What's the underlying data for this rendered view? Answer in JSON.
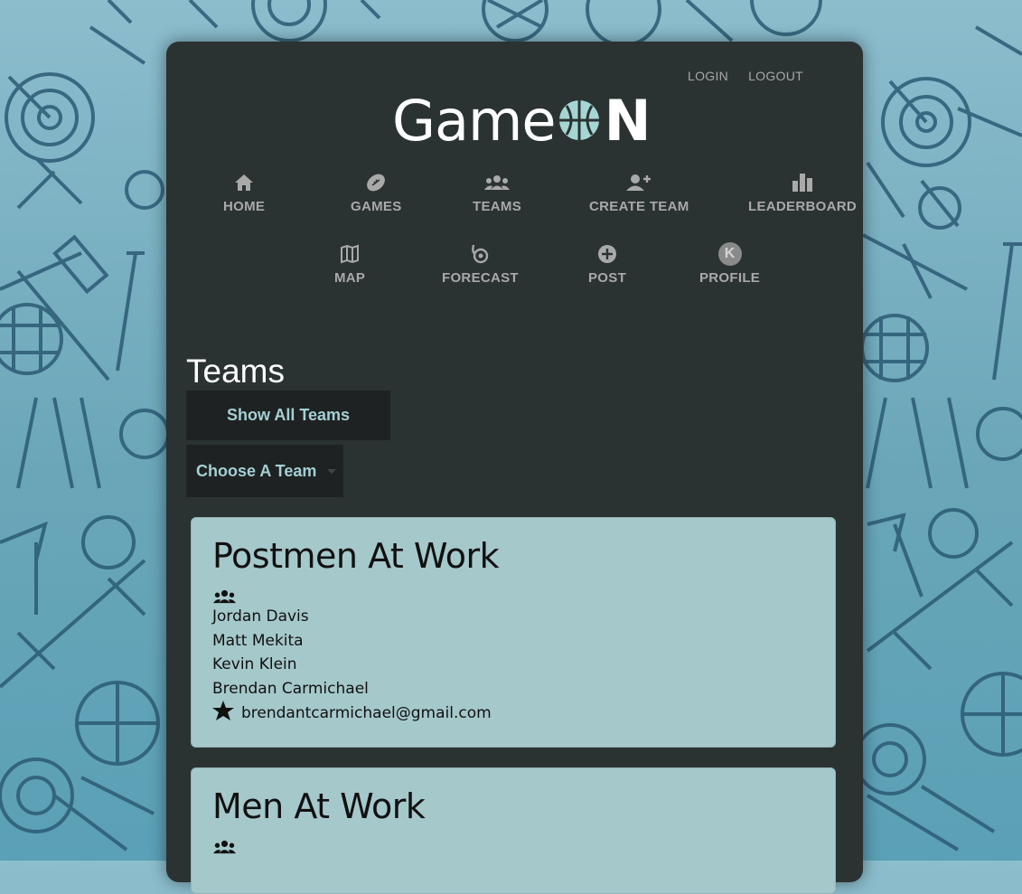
{
  "header": {
    "login_label": "LOGIN",
    "logout_label": "LOGOUT",
    "logo": {
      "word": "Game",
      "n": "N"
    }
  },
  "nav": {
    "items": [
      {
        "label": "HOME",
        "icon": "home-icon"
      },
      {
        "label": "GAMES",
        "icon": "football-icon"
      },
      {
        "label": "TEAMS",
        "icon": "people-icon"
      },
      {
        "label": "CREATE TEAM",
        "icon": "add-user-icon"
      },
      {
        "label": "LEADERBOARD",
        "icon": "bar-chart-icon"
      },
      {
        "label": "MAP",
        "icon": "map-icon"
      },
      {
        "label": "FORECAST",
        "icon": "hurricane-icon"
      },
      {
        "label": "POST",
        "icon": "plus-circle-icon"
      },
      {
        "label": "PROFILE",
        "icon": "avatar-icon",
        "avatar_letter": "K"
      }
    ]
  },
  "main": {
    "title": "Teams",
    "show_all_label": "Show All Teams",
    "choose_team_label": "Choose A Team",
    "teams": [
      {
        "name": "Postmen At Work",
        "members": [
          "Jordan Davis",
          "Matt Mekita",
          "Kevin Klein",
          "Brendan Carmichael"
        ],
        "captain_email": "brendantcarmichael@gmail.com"
      },
      {
        "name": "Men At Work",
        "members": [],
        "captain_email": ""
      }
    ]
  },
  "colors": {
    "panel": "#2b3232",
    "card": "#a5c8cb",
    "accent_text": "#a4cfd3",
    "nav_text": "#a9a9a9",
    "background": "#6aa6b8"
  }
}
